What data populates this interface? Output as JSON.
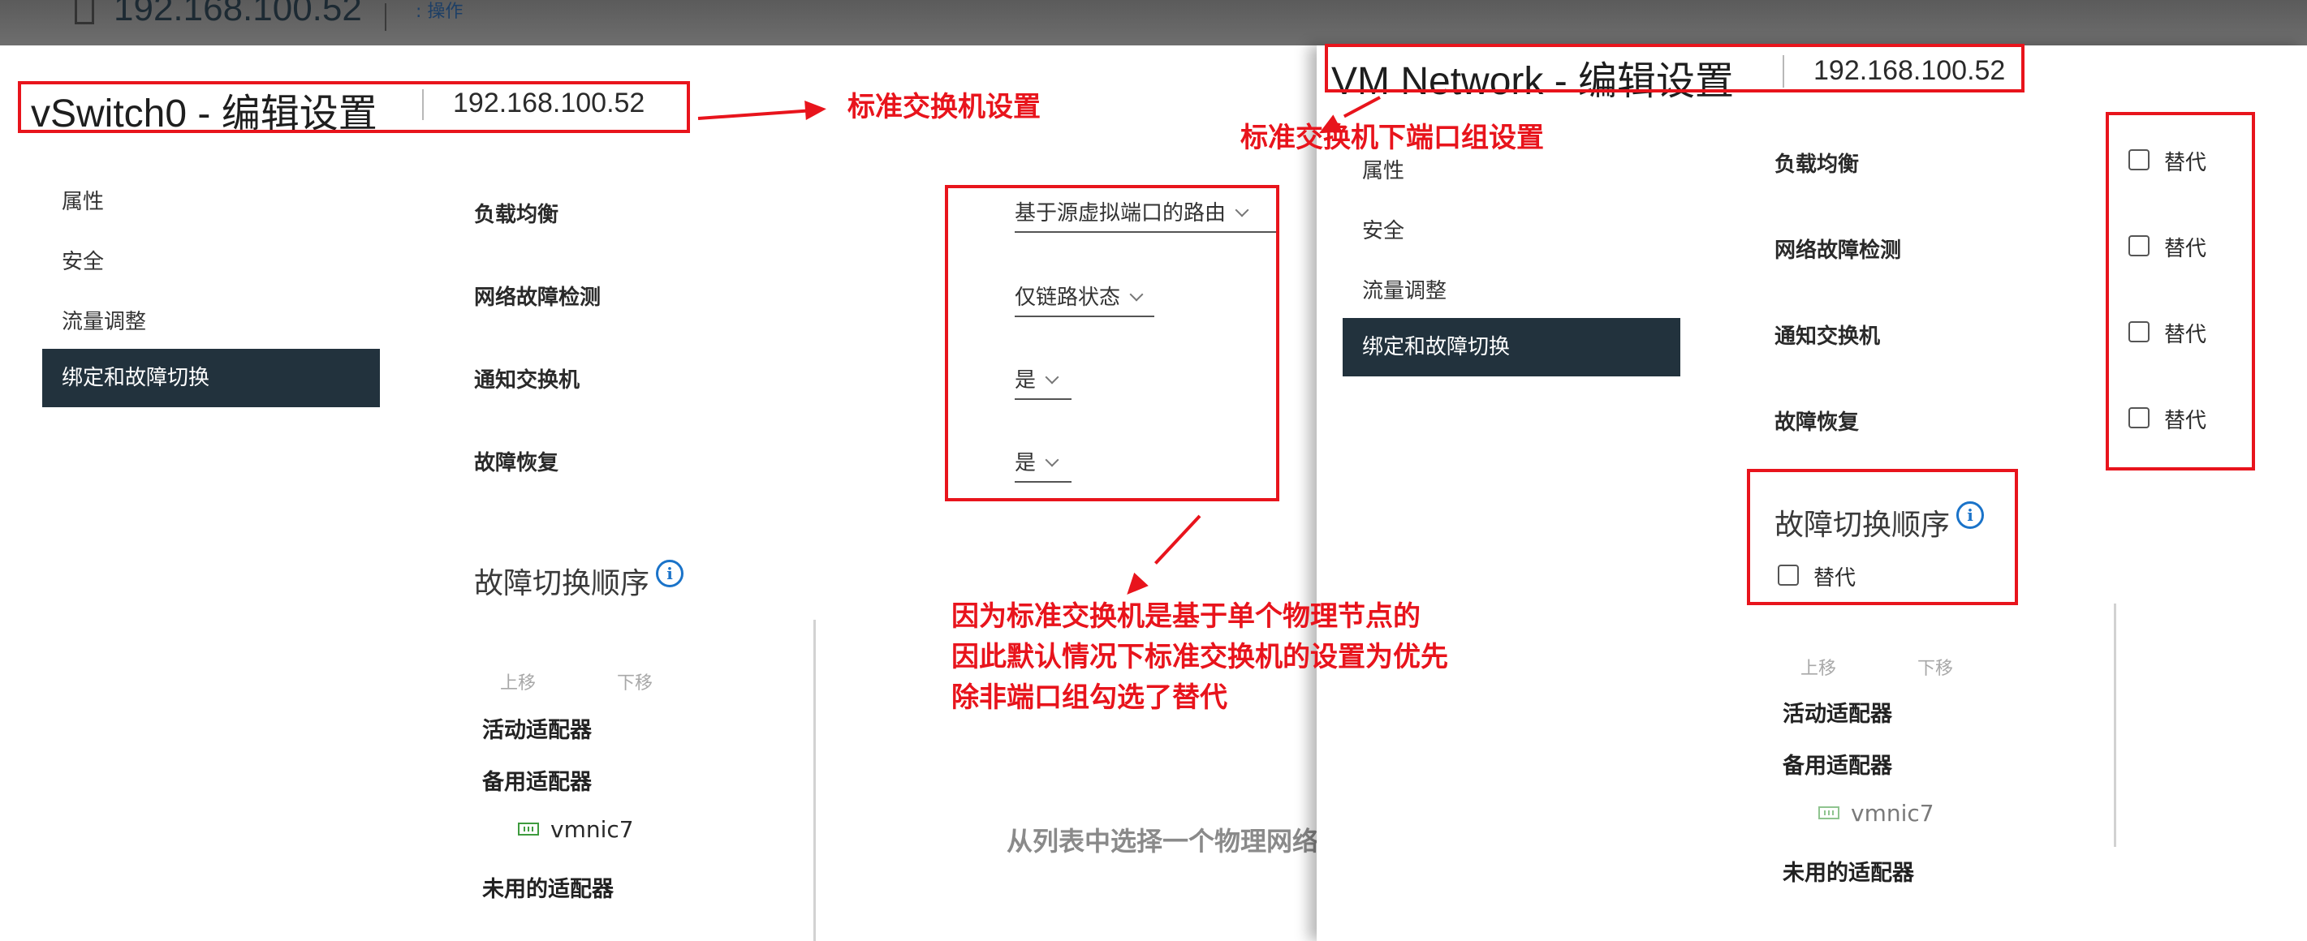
{
  "top_bar": {
    "host": "192.168.100.52",
    "actions_label": ": 操作"
  },
  "left_panel": {
    "title": "vSwitch0 - 编辑设置",
    "ip": "192.168.100.52",
    "nav": [
      "属性",
      "安全",
      "流量调整",
      "绑定和故障切换"
    ],
    "fields": [
      {
        "label": "负载均衡",
        "value": "基于源虚拟端口的路由"
      },
      {
        "label": "网络故障检测",
        "value": "仅链路状态"
      },
      {
        "label": "通知交换机",
        "value": "是"
      },
      {
        "label": "故障恢复",
        "value": "是"
      }
    ],
    "failover_title": "故障切换顺序",
    "move_up": "上移",
    "move_down": "下移",
    "active_adapters": "活动适配器",
    "standby_adapters": "备用适配器",
    "nic": "vmnic7",
    "unused_adapters": "未用的适配器",
    "empty_hint": "从列表中选择一个物理网络"
  },
  "right_panel": {
    "title": "VM Network - 编辑设置",
    "ip": "192.168.100.52",
    "nav": [
      "属性",
      "安全",
      "流量调整",
      "绑定和故障切换"
    ],
    "fields": [
      "负载均衡",
      "网络故障检测",
      "通知交换机",
      "故障恢复"
    ],
    "override_label": "替代",
    "failover_title": "故障切换顺序",
    "failover_override": "替代",
    "move_up": "上移",
    "move_down": "下移",
    "active_adapters": "活动适配器",
    "standby_adapters": "备用适配器",
    "nic": "vmnic7",
    "unused_adapters": "未用的适配器"
  },
  "annotations": {
    "std_switch_settings": "标准交换机设置",
    "port_group_settings": "标准交换机下端口组设置",
    "note_lines": [
      "因为标准交换机是基于单个物理节点的",
      "因此默认情况下标准交换机的设置为优先",
      "除非端口组勾选了替代"
    ],
    "color": "#e8141c"
  }
}
